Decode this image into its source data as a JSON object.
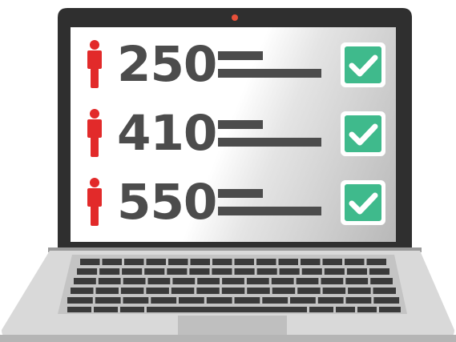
{
  "colors": {
    "bezel": "#2f2f2f",
    "body": "#d6d6d6",
    "keyboard_deck": "#cbcbcb",
    "key": "#3a3a3a",
    "person": "#e22a2a",
    "number": "#4c4c4c",
    "check_fill": "#3fba8c",
    "camera": "#e8503a"
  },
  "rows": [
    {
      "icon": "person-icon",
      "count": "250",
      "status_icon": "checkbox-checked-icon",
      "checked": true
    },
    {
      "icon": "person-icon",
      "count": "410",
      "status_icon": "checkbox-checked-icon",
      "checked": true
    },
    {
      "icon": "person-icon",
      "count": "550",
      "status_icon": "checkbox-checked-icon",
      "checked": true
    }
  ]
}
